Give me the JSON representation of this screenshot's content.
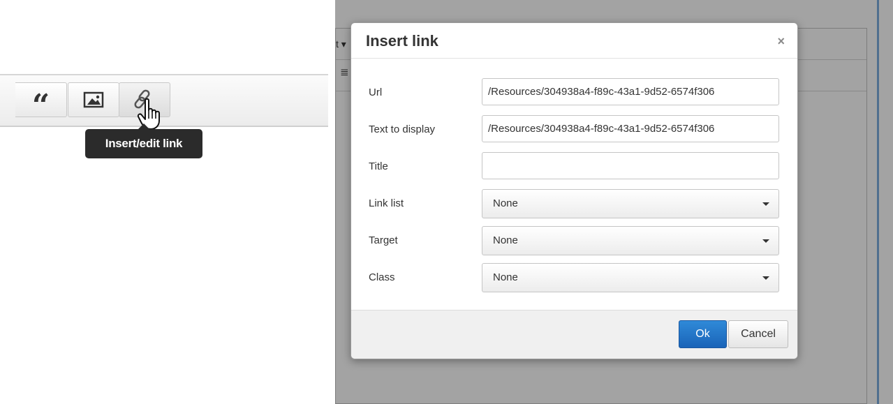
{
  "toolbar": {
    "quote_icon": "blockquote-icon",
    "image_icon": "image-icon",
    "link_icon": "link-icon",
    "tooltip": "Insert/edit link"
  },
  "editor": {
    "menubar_fragment": "t ▾",
    "toolbar_fragment": "≣"
  },
  "dialog": {
    "title": "Insert link",
    "close_label": "×",
    "fields": {
      "url": {
        "label": "Url",
        "value": "/Resources/304938a4-f89c-43a1-9d52-6574f306"
      },
      "text": {
        "label": "Text to display",
        "value": "/Resources/304938a4-f89c-43a1-9d52-6574f306"
      },
      "title": {
        "label": "Title",
        "value": ""
      },
      "link_list": {
        "label": "Link list",
        "selected": "None"
      },
      "target": {
        "label": "Target",
        "selected": "None"
      },
      "class": {
        "label": "Class",
        "selected": "None"
      }
    },
    "ok_label": "Ok",
    "cancel_label": "Cancel"
  },
  "colors": {
    "ok_button": "#1a64b8",
    "overlay": "#a3a3a3",
    "tooltip_bg": "#2b2b2b"
  }
}
